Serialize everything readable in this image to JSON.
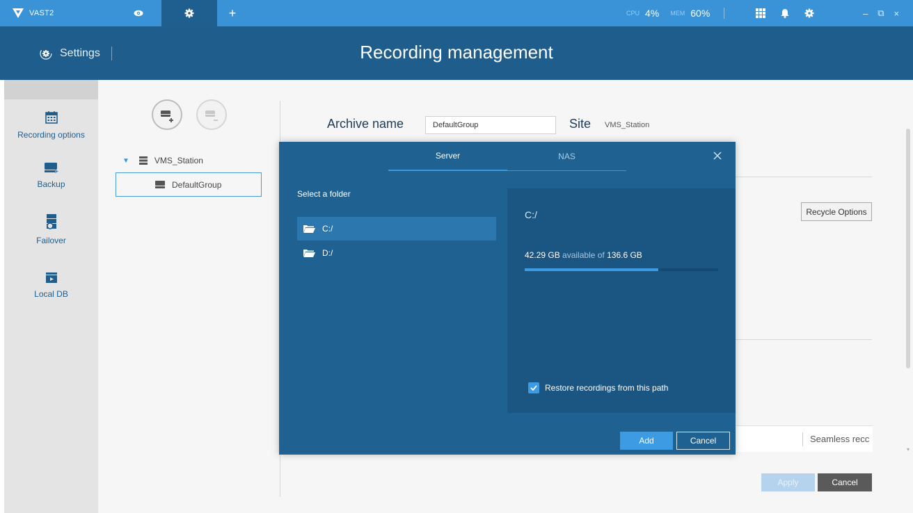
{
  "app": {
    "name": "VAST2"
  },
  "topbar": {
    "cpu_label": "CPU",
    "cpu_value": "4%",
    "mem_label": "MEM",
    "mem_value": "60%",
    "add_tab": "+",
    "minimize": "–",
    "restore": "⧉",
    "close": "×"
  },
  "header": {
    "breadcrumb": "Settings",
    "title": "Recording management"
  },
  "sidebar": {
    "items": [
      {
        "label": "Recording options",
        "icon": "calendar-icon"
      },
      {
        "label": "Backup",
        "icon": "drive-icon"
      },
      {
        "label": "Failover",
        "icon": "server-sync-icon"
      },
      {
        "label": "Local DB",
        "icon": "database-folder-icon"
      }
    ]
  },
  "tree": {
    "root": "VMS_Station",
    "child": "DefaultGroup"
  },
  "form": {
    "archive_label": "Archive name",
    "archive_value": "DefaultGroup",
    "site_label": "Site",
    "site_value": "VMS_Station",
    "recycle_button": "Recycle Options",
    "seamless_text": "Seamless recc",
    "apply_button": "Apply",
    "cancel_button": "Cancel"
  },
  "dialog": {
    "tabs": [
      "Server",
      "NAS"
    ],
    "active_tab": "Server",
    "select_label": "Select a folder",
    "folders": [
      "C:/",
      "D:/"
    ],
    "selected_folder": "C:/",
    "path": "C:/",
    "available": "42.29 GB",
    "available_text": "available of",
    "total": "136.6 GB",
    "used_fraction": 0.69,
    "restore_label": "Restore recordings from this path",
    "restore_checked": true,
    "add_button": "Add",
    "cancel_button": "Cancel"
  },
  "colors": {
    "topbar": "#3a93d6",
    "header": "#1e5d8c",
    "dialog": "#1f6191",
    "accent": "#3d9be3"
  }
}
